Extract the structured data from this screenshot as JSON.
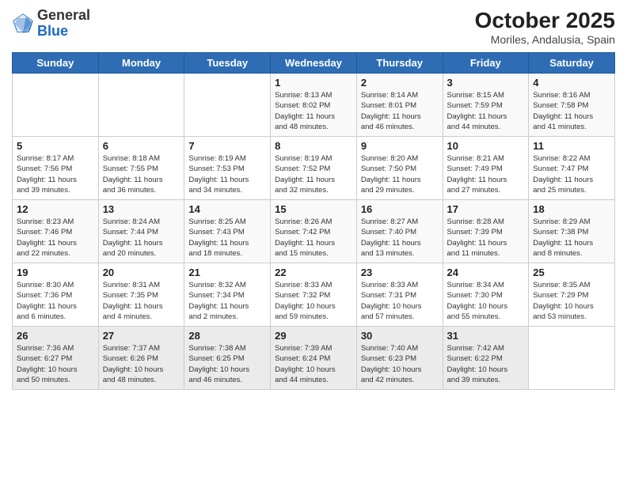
{
  "header": {
    "logo_general": "General",
    "logo_blue": "Blue",
    "month_title": "October 2025",
    "location": "Moriles, Andalusia, Spain"
  },
  "weekdays": [
    "Sunday",
    "Monday",
    "Tuesday",
    "Wednesday",
    "Thursday",
    "Friday",
    "Saturday"
  ],
  "weeks": [
    [
      {
        "day": "",
        "info": ""
      },
      {
        "day": "",
        "info": ""
      },
      {
        "day": "",
        "info": ""
      },
      {
        "day": "1",
        "info": "Sunrise: 8:13 AM\nSunset: 8:02 PM\nDaylight: 11 hours\nand 48 minutes."
      },
      {
        "day": "2",
        "info": "Sunrise: 8:14 AM\nSunset: 8:01 PM\nDaylight: 11 hours\nand 46 minutes."
      },
      {
        "day": "3",
        "info": "Sunrise: 8:15 AM\nSunset: 7:59 PM\nDaylight: 11 hours\nand 44 minutes."
      },
      {
        "day": "4",
        "info": "Sunrise: 8:16 AM\nSunset: 7:58 PM\nDaylight: 11 hours\nand 41 minutes."
      }
    ],
    [
      {
        "day": "5",
        "info": "Sunrise: 8:17 AM\nSunset: 7:56 PM\nDaylight: 11 hours\nand 39 minutes."
      },
      {
        "day": "6",
        "info": "Sunrise: 8:18 AM\nSunset: 7:55 PM\nDaylight: 11 hours\nand 36 minutes."
      },
      {
        "day": "7",
        "info": "Sunrise: 8:19 AM\nSunset: 7:53 PM\nDaylight: 11 hours\nand 34 minutes."
      },
      {
        "day": "8",
        "info": "Sunrise: 8:19 AM\nSunset: 7:52 PM\nDaylight: 11 hours\nand 32 minutes."
      },
      {
        "day": "9",
        "info": "Sunrise: 8:20 AM\nSunset: 7:50 PM\nDaylight: 11 hours\nand 29 minutes."
      },
      {
        "day": "10",
        "info": "Sunrise: 8:21 AM\nSunset: 7:49 PM\nDaylight: 11 hours\nand 27 minutes."
      },
      {
        "day": "11",
        "info": "Sunrise: 8:22 AM\nSunset: 7:47 PM\nDaylight: 11 hours\nand 25 minutes."
      }
    ],
    [
      {
        "day": "12",
        "info": "Sunrise: 8:23 AM\nSunset: 7:46 PM\nDaylight: 11 hours\nand 22 minutes."
      },
      {
        "day": "13",
        "info": "Sunrise: 8:24 AM\nSunset: 7:44 PM\nDaylight: 11 hours\nand 20 minutes."
      },
      {
        "day": "14",
        "info": "Sunrise: 8:25 AM\nSunset: 7:43 PM\nDaylight: 11 hours\nand 18 minutes."
      },
      {
        "day": "15",
        "info": "Sunrise: 8:26 AM\nSunset: 7:42 PM\nDaylight: 11 hours\nand 15 minutes."
      },
      {
        "day": "16",
        "info": "Sunrise: 8:27 AM\nSunset: 7:40 PM\nDaylight: 11 hours\nand 13 minutes."
      },
      {
        "day": "17",
        "info": "Sunrise: 8:28 AM\nSunset: 7:39 PM\nDaylight: 11 hours\nand 11 minutes."
      },
      {
        "day": "18",
        "info": "Sunrise: 8:29 AM\nSunset: 7:38 PM\nDaylight: 11 hours\nand 8 minutes."
      }
    ],
    [
      {
        "day": "19",
        "info": "Sunrise: 8:30 AM\nSunset: 7:36 PM\nDaylight: 11 hours\nand 6 minutes."
      },
      {
        "day": "20",
        "info": "Sunrise: 8:31 AM\nSunset: 7:35 PM\nDaylight: 11 hours\nand 4 minutes."
      },
      {
        "day": "21",
        "info": "Sunrise: 8:32 AM\nSunset: 7:34 PM\nDaylight: 11 hours\nand 2 minutes."
      },
      {
        "day": "22",
        "info": "Sunrise: 8:33 AM\nSunset: 7:32 PM\nDaylight: 10 hours\nand 59 minutes."
      },
      {
        "day": "23",
        "info": "Sunrise: 8:33 AM\nSunset: 7:31 PM\nDaylight: 10 hours\nand 57 minutes."
      },
      {
        "day": "24",
        "info": "Sunrise: 8:34 AM\nSunset: 7:30 PM\nDaylight: 10 hours\nand 55 minutes."
      },
      {
        "day": "25",
        "info": "Sunrise: 8:35 AM\nSunset: 7:29 PM\nDaylight: 10 hours\nand 53 minutes."
      }
    ],
    [
      {
        "day": "26",
        "info": "Sunrise: 7:36 AM\nSunset: 6:27 PM\nDaylight: 10 hours\nand 50 minutes."
      },
      {
        "day": "27",
        "info": "Sunrise: 7:37 AM\nSunset: 6:26 PM\nDaylight: 10 hours\nand 48 minutes."
      },
      {
        "day": "28",
        "info": "Sunrise: 7:38 AM\nSunset: 6:25 PM\nDaylight: 10 hours\nand 46 minutes."
      },
      {
        "day": "29",
        "info": "Sunrise: 7:39 AM\nSunset: 6:24 PM\nDaylight: 10 hours\nand 44 minutes."
      },
      {
        "day": "30",
        "info": "Sunrise: 7:40 AM\nSunset: 6:23 PM\nDaylight: 10 hours\nand 42 minutes."
      },
      {
        "day": "31",
        "info": "Sunrise: 7:42 AM\nSunset: 6:22 PM\nDaylight: 10 hours\nand 39 minutes."
      },
      {
        "day": "",
        "info": ""
      }
    ]
  ]
}
